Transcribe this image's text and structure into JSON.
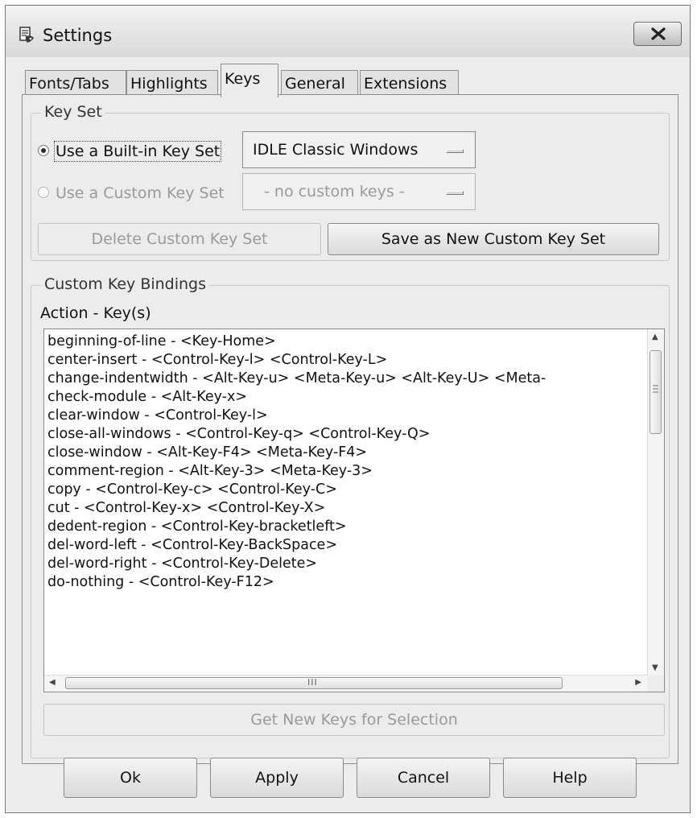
{
  "window": {
    "title": "Settings"
  },
  "tabs": [
    {
      "label": "Fonts/Tabs"
    },
    {
      "label": "Highlights"
    },
    {
      "label": "Keys"
    },
    {
      "label": "General"
    },
    {
      "label": "Extensions"
    }
  ],
  "active_tab": "Keys",
  "key_set": {
    "group_title": "Key Set",
    "builtin_label": "Use a Built-in Key Set",
    "builtin_selected": true,
    "builtin_value": "IDLE Classic Windows",
    "custom_label": "Use a Custom Key Set",
    "custom_value": "- no custom keys -",
    "delete_label": "Delete Custom Key Set",
    "save_label": "Save as New Custom Key Set"
  },
  "bindings": {
    "group_title": "Custom Key Bindings",
    "list_header": "Action - Key(s)",
    "items": [
      "beginning-of-line - <Key-Home>",
      "center-insert - <Control-Key-l> <Control-Key-L>",
      "change-indentwidth - <Alt-Key-u> <Meta-Key-u> <Alt-Key-U> <Meta-",
      "check-module - <Alt-Key-x>",
      "clear-window - <Control-Key-l>",
      "close-all-windows - <Control-Key-q> <Control-Key-Q>",
      "close-window - <Alt-Key-F4> <Meta-Key-F4>",
      "comment-region - <Alt-Key-3> <Meta-Key-3>",
      "copy - <Control-Key-c> <Control-Key-C>",
      "cut - <Control-Key-x> <Control-Key-X>",
      "dedent-region - <Control-Key-bracketleft>",
      "del-word-left - <Control-Key-BackSpace>",
      "del-word-right - <Control-Key-Delete>",
      "do-nothing - <Control-Key-F12>"
    ],
    "get_new_keys_label": "Get New Keys for Selection",
    "hscroll_grip": "III"
  },
  "buttons": {
    "ok": "Ok",
    "apply": "Apply",
    "cancel": "Cancel",
    "help": "Help"
  },
  "colors": {
    "window_bg": "#ececec",
    "disabled_text": "#9a9a9a",
    "list_bg": "#ffffff"
  }
}
